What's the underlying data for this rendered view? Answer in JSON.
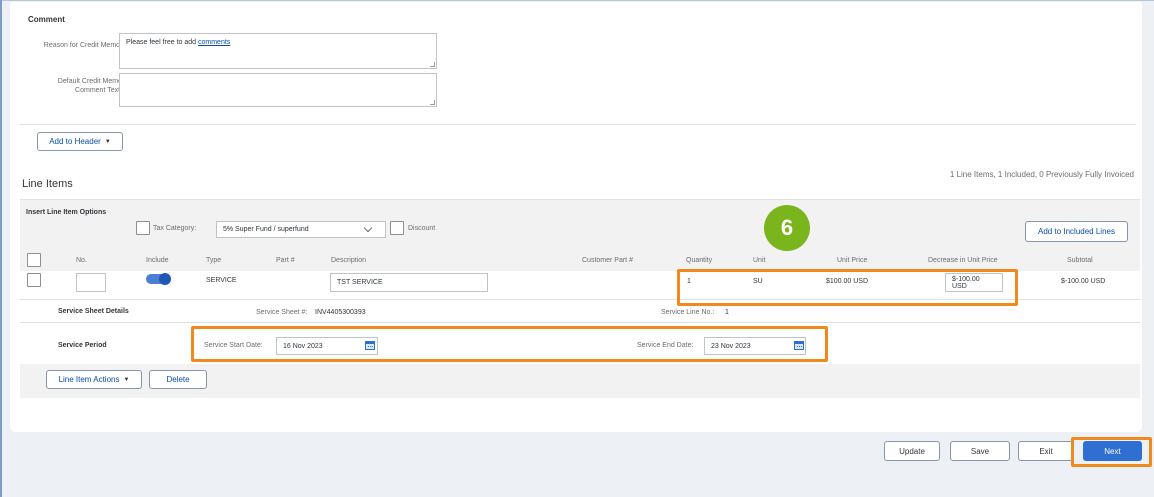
{
  "comment": {
    "section_title": "Comment",
    "reason_label": "Reason for Credit Memo:",
    "reason_text_prefix": "Please feel free to add ",
    "reason_text_link": "comments",
    "default_label_line1": "Default Credit Memo",
    "default_label_line2": "Comment Text:",
    "default_text": ""
  },
  "header_actions": {
    "add_to_header_label": "Add to Header"
  },
  "line_items": {
    "title": "Line Items",
    "summary": "1 Line Items,  1 Included,  0 Previously Fully Invoiced",
    "insert_options_label": "Insert Line Item Options",
    "tax_category_label": "Tax Category:",
    "tax_category_value": "5% Super Fund / superfund",
    "discount_label": "Discount",
    "add_to_included_label": "Add to Included Lines",
    "columns": {
      "no": "No.",
      "include": "Include",
      "type": "Type",
      "part": "Part #",
      "description": "Description",
      "customer_part": "Customer Part #",
      "quantity": "Quantity",
      "unit": "Unit",
      "unit_price": "Unit Price",
      "decrease": "Decrease in Unit Price",
      "subtotal": "Subtotal"
    },
    "row": {
      "no": "",
      "include": true,
      "type": "SERVICE",
      "description": "TST SERVICE",
      "quantity": "1",
      "unit": "SU",
      "unit_price": "$100.00 USD",
      "decrease": "$-100.00 USD",
      "subtotal": "$-100.00 USD"
    },
    "service_sheet": {
      "label": "Service Sheet Details",
      "sheet_no_label": "Service Sheet #:",
      "sheet_no_value": "INV4405300393",
      "line_no_label": "Service Line No.:",
      "line_no_value": "1"
    },
    "service_period": {
      "label": "Service Period",
      "start_label": "Service Start Date:",
      "start_value": "16 Nov 2023",
      "end_label": "Service End Date:",
      "end_value": "23 Nov 2023"
    },
    "line_item_actions_label": "Line Item Actions",
    "delete_label": "Delete"
  },
  "footer": {
    "update_label": "Update",
    "save_label": "Save",
    "exit_label": "Exit",
    "next_label": "Next"
  },
  "annotation": {
    "step_number": "6",
    "highlight_color": "#f08a1c",
    "badge_color": "#7ab51d"
  }
}
